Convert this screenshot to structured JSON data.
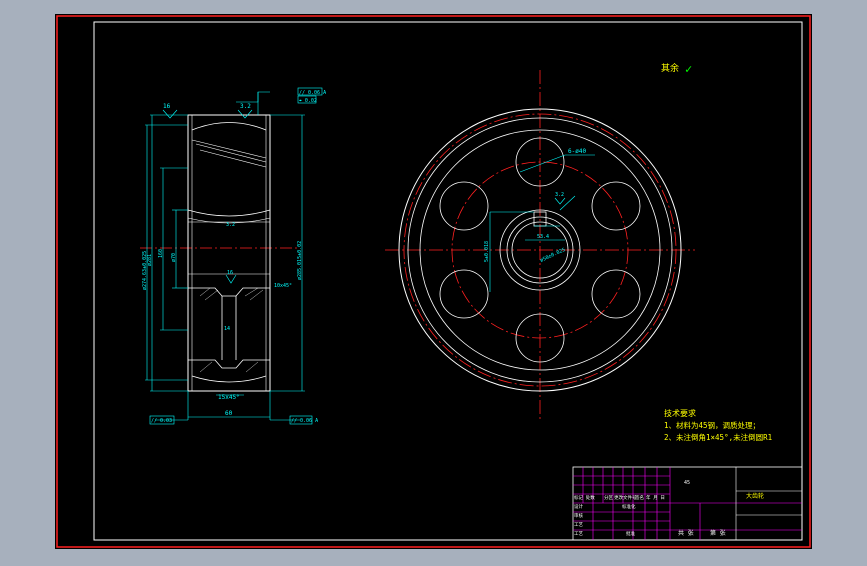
{
  "drawing": {
    "roughness_note": "其余",
    "roughness_check": "✓",
    "side_view": {
      "roughness_top_left": "16",
      "roughness_top_mid": "3.2",
      "roughness_mid": "3.2",
      "roughness_lower": "16",
      "tolerance_box_1": "// 0.06 A",
      "tolerance_box_2": "⌖ 0.02",
      "dim_hub": "ø70",
      "dim_web": "160",
      "dim_outer_vertical": "ø274.63±0.025",
      "dim_tip_vertical": "ø281",
      "dim_right_vertical": "ø285.015±0.02",
      "dim_chamfer_right": "10x45°",
      "dim_width_bottom": "60",
      "dim_chamfer_bottom": "15x45°",
      "dim_web_thickness": "14",
      "label_left_box": "// 0.03",
      "label_right_box": "// 0.06 A"
    },
    "front_view": {
      "hole_label": "6-ø40",
      "key_dim": "5±0.018",
      "bore_dim": "ø50±0.025",
      "key_depth": "53.4",
      "roughness_key": "3.2"
    },
    "tech_requirements": {
      "title": "技术要求",
      "line1": "1、材料为45钢，调质处理；",
      "line2": "2、未注倒角1×45°,未注倒圆R1"
    },
    "title_block": {
      "scale_value": "45",
      "part_name": "大齿轮",
      "row_mark": "标记 处数",
      "row_change": "分区",
      "row_doc": "更改文件号",
      "row_sign": "签名",
      "row_date": "年 月 日",
      "row_design": "设计",
      "row_std": "标准化",
      "row_review": "审核",
      "row_process": "工艺",
      "row_approve": "批准",
      "count_label": "共 张",
      "sheet_label": "第 张"
    },
    "colors": {
      "background": "#000000",
      "outline": "#ffffff",
      "dimension": "#00ffff",
      "centerline": "#ff0000",
      "title_grid": "#ff00ff",
      "note": "#ffff00",
      "check": "#00ff00",
      "frame": "#ff0000"
    }
  }
}
